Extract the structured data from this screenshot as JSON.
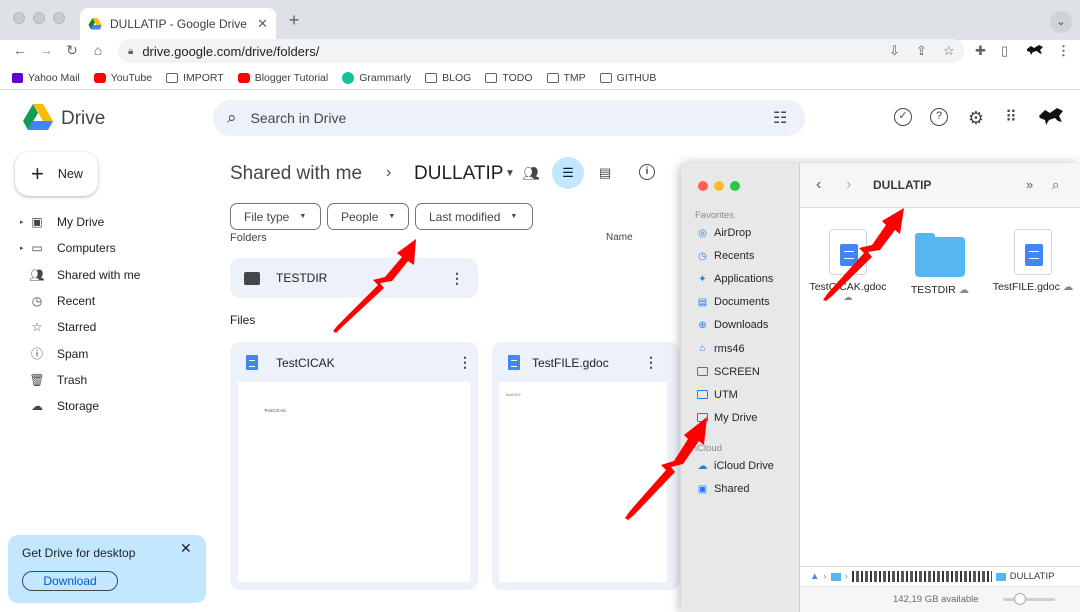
{
  "browser": {
    "tab_title": "DULLATIP - Google Drive",
    "tab_close": "✕",
    "new_tab": "+",
    "tab_menu": "⌄",
    "url": "drive.google.com/drive/folders/",
    "bookmarks": [
      {
        "label": "Yahoo Mail",
        "icon": "yahoo-icon"
      },
      {
        "label": "YouTube",
        "icon": "youtube-icon"
      },
      {
        "label": "IMPORT",
        "icon": "folder-icon"
      },
      {
        "label": "Blogger Tutorial",
        "icon": "youtube-icon"
      },
      {
        "label": "Grammarly",
        "icon": "grammarly-icon"
      },
      {
        "label": "BLOG",
        "icon": "folder-icon"
      },
      {
        "label": "TODO",
        "icon": "folder-icon"
      },
      {
        "label": "TMP",
        "icon": "folder-icon"
      },
      {
        "label": "GITHUB",
        "icon": "folder-icon"
      }
    ]
  },
  "drive": {
    "app_title": "Drive",
    "search_placeholder": "Search in Drive",
    "new_label": "New",
    "sidebar": [
      {
        "label": "My Drive",
        "icon": "my-drive-icon",
        "expandable": true
      },
      {
        "label": "Computers",
        "icon": "computers-icon",
        "expandable": true
      },
      {
        "label": "Shared with me",
        "icon": "people-icon",
        "expandable": false
      },
      {
        "label": "Recent",
        "icon": "clock-icon",
        "expandable": false
      },
      {
        "label": "Starred",
        "icon": "star-icon",
        "expandable": false
      },
      {
        "label": "Spam",
        "icon": "spam-icon",
        "expandable": false
      },
      {
        "label": "Trash",
        "icon": "trash-icon",
        "expandable": false
      },
      {
        "label": "Storage",
        "icon": "cloud-icon",
        "expandable": false
      }
    ],
    "promo": {
      "text": "Get Drive for desktop",
      "button": "Download"
    },
    "breadcrumb": {
      "parent": "Shared with me",
      "current": "DULLATIP"
    },
    "filters": [
      "File type",
      "People",
      "Last modified"
    ],
    "folders_label": "Folders",
    "name_sort_label": "Name",
    "folders": [
      {
        "name": "TESTDIR"
      }
    ],
    "files_label": "Files",
    "files": [
      {
        "name": "TestCICAK",
        "preview_text": "TestCICAK"
      },
      {
        "name": "TestFILE.gdoc",
        "preview_text": "testFILE"
      }
    ]
  },
  "finder": {
    "title": "DULLATIP",
    "favorites_label": "Favorites",
    "favorites": [
      {
        "label": "AirDrop",
        "icon": "airdrop-icon"
      },
      {
        "label": "Recents",
        "icon": "clock-icon"
      },
      {
        "label": "Applications",
        "icon": "applications-icon"
      },
      {
        "label": "Documents",
        "icon": "document-icon"
      },
      {
        "label": "Downloads",
        "icon": "download-icon"
      },
      {
        "label": "rms46",
        "icon": "home-icon"
      },
      {
        "label": "SCREEN",
        "icon": "folder-icon"
      },
      {
        "label": "UTM",
        "icon": "folder-icon"
      },
      {
        "label": "My Drive",
        "icon": "folder-icon"
      }
    ],
    "icloud_label": "iCloud",
    "icloud": [
      {
        "label": "iCloud Drive",
        "icon": "icloud-icon"
      },
      {
        "label": "Shared",
        "icon": "shared-folder-icon"
      }
    ],
    "items": [
      {
        "name": "TestCICAK.gdoc",
        "type": "gdoc"
      },
      {
        "name": "TESTDIR",
        "type": "folder"
      },
      {
        "name": "TestFILE.gdoc",
        "type": "gdoc"
      }
    ],
    "path_end": "DULLATIP",
    "status": "142,19 GB available"
  },
  "colors": {
    "accent": "#0b57d0",
    "annotation_arrow": "#ff0000",
    "drive_surface": "#edf1f9"
  }
}
